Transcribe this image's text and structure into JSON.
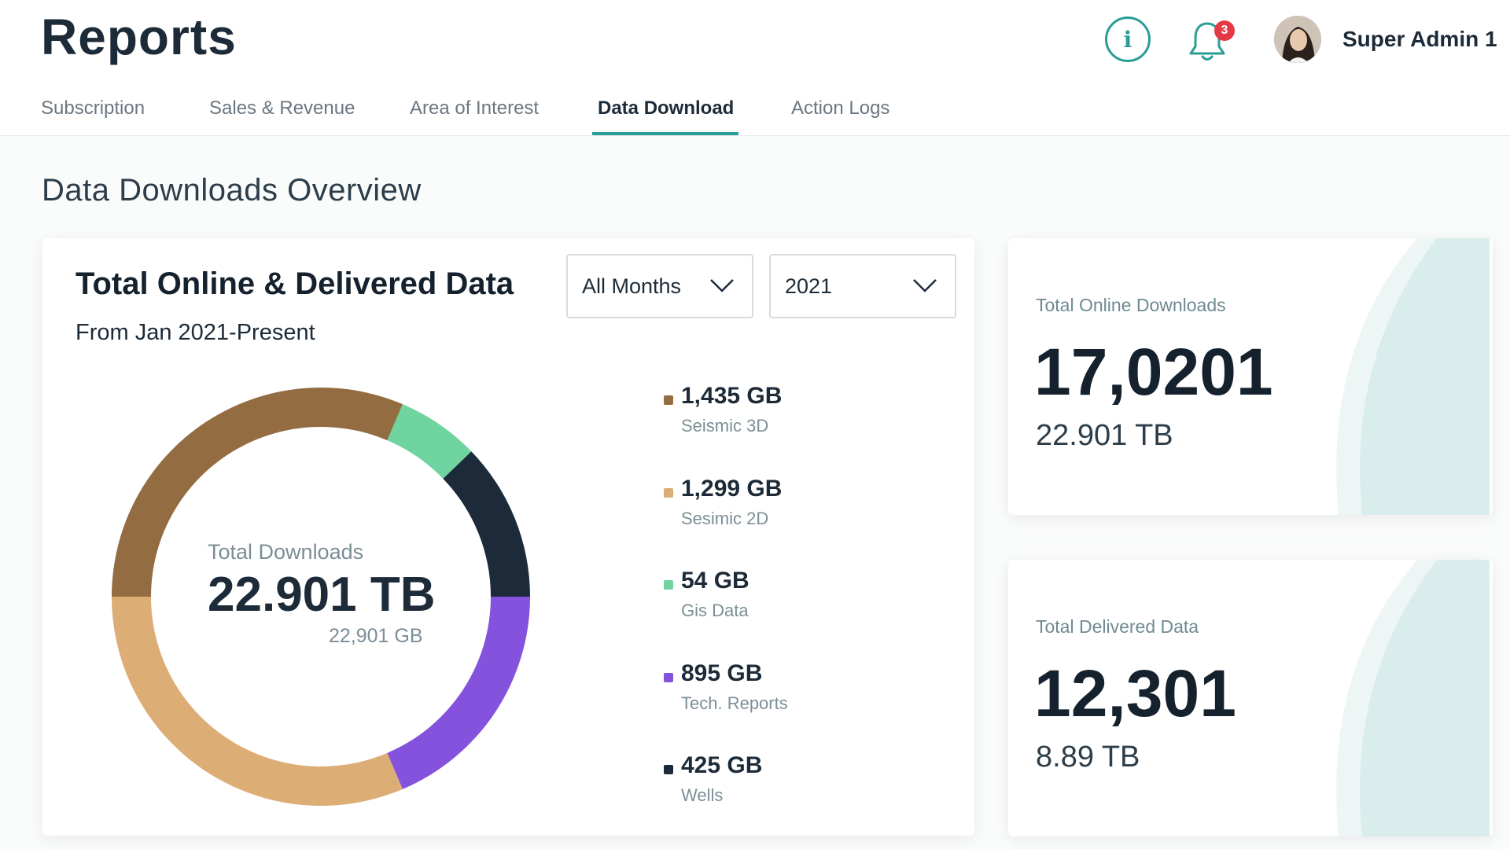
{
  "header": {
    "title": "Reports",
    "notifications_count": "3",
    "user_name": "Super Admin 1"
  },
  "tabs": [
    {
      "label": "Subscription"
    },
    {
      "label": "Sales & Revenue"
    },
    {
      "label": "Area of Interest"
    },
    {
      "label": "Data Download",
      "active": true
    },
    {
      "label": "Action Logs"
    }
  ],
  "section_title": "Data Downloads Overview",
  "main_card": {
    "title": "Total Online & Delivered Data",
    "subtitle": "From Jan 2021-Present",
    "month_select": "All Months",
    "year_select": "2021",
    "center_label": "Total Downloads",
    "center_value": "22.901 TB",
    "center_sub": "22,901 GB"
  },
  "chart_data": {
    "type": "pie",
    "categories": [
      "Seismic 3D",
      "Sesimic 2D",
      "Gis Data",
      "Tech. Reports",
      "Wells"
    ],
    "values": [
      1435,
      1299,
      54,
      895,
      425
    ],
    "value_labels": [
      "1,435 GB",
      "1,299 GB",
      "54 GB",
      "895 GB",
      "425 GB"
    ],
    "colors": [
      "#946c41",
      "#dcad75",
      "#6fd49f",
      "#8452dc",
      "#1c2a3a"
    ],
    "donut_segments_degrees": [
      {
        "category": "Gis Data",
        "start": 23,
        "end": 46,
        "color": "#6fd49f"
      },
      {
        "category": "Wells",
        "start": 46,
        "end": 90,
        "color": "#1c2a3a"
      },
      {
        "category": "Tech. Reports",
        "start": 90,
        "end": 157,
        "color": "#8452dc"
      },
      {
        "category": "Sesimic 2D",
        "start": 157,
        "end": 270,
        "color": "#dcad75"
      },
      {
        "category": "Seismic 3D",
        "start": 270,
        "end": 383,
        "color": "#946c41"
      }
    ]
  },
  "stats": [
    {
      "label": "Total Online Downloads",
      "value": "17,0201",
      "sub": "22.901 TB"
    },
    {
      "label": "Total Delivered Data",
      "value": "12,301",
      "sub": "8.89 TB"
    }
  ],
  "colors": {
    "accent": "#2a9d96",
    "badge": "#e63946",
    "card_deco_light": "#eef6f5",
    "card_deco": "#d9eeec"
  }
}
